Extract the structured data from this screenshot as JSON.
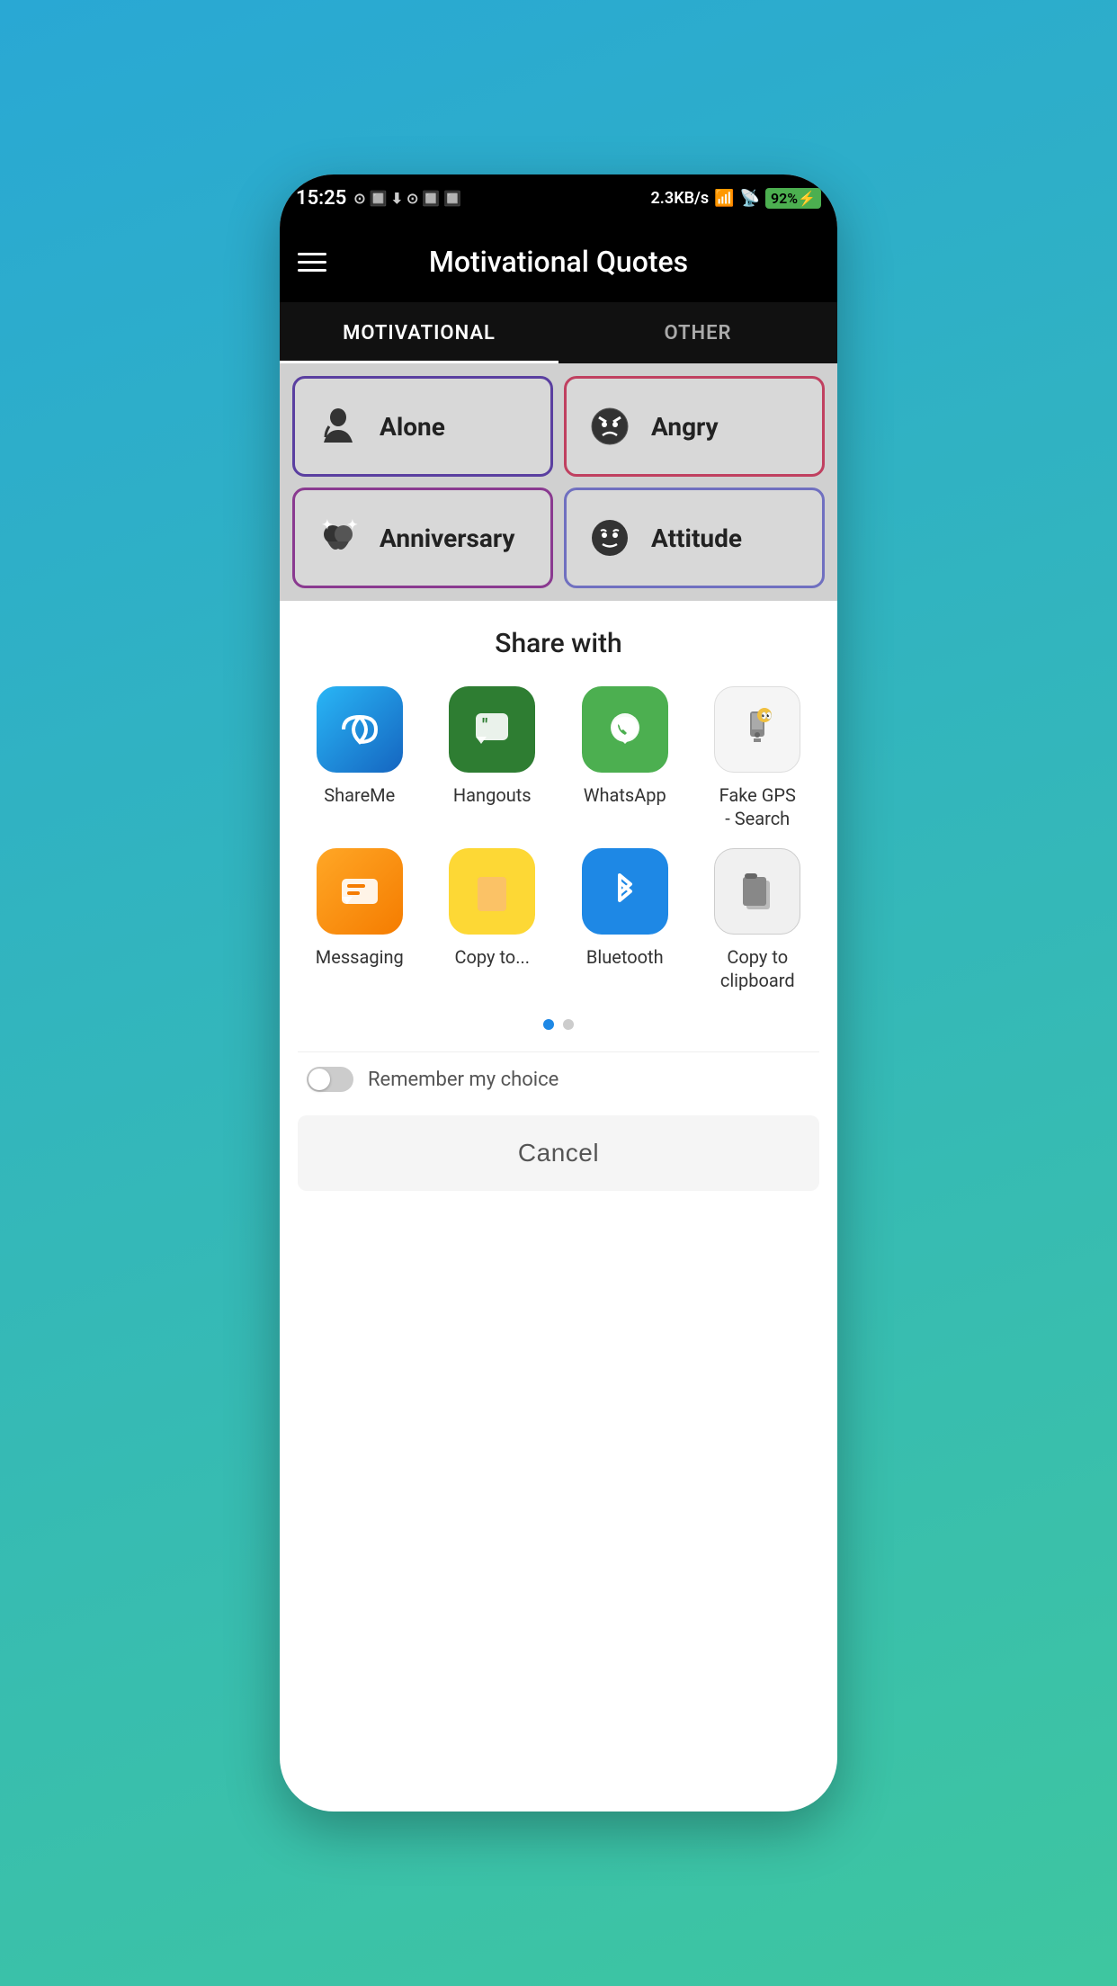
{
  "statusBar": {
    "time": "15:25",
    "speed": "2.3KB/s",
    "battery": "92"
  },
  "appBar": {
    "title": "Motivational Quotes",
    "menuIcon": "menu-icon"
  },
  "tabs": [
    {
      "id": "motivational",
      "label": "MOTIVATIONAL",
      "active": true
    },
    {
      "id": "other",
      "label": "OTHER",
      "active": false
    }
  ],
  "categories": [
    {
      "id": "alone",
      "label": "Alone",
      "icon": "🧎",
      "borderClass": "alone"
    },
    {
      "id": "angry",
      "label": "Angry",
      "icon": "😠",
      "borderClass": "angry"
    },
    {
      "id": "anniversary",
      "label": "Anniversary",
      "icon": "💑",
      "borderClass": "anniversary"
    },
    {
      "id": "attitude",
      "label": "Attitude",
      "icon": "😏",
      "borderClass": "attitude"
    }
  ],
  "shareSheet": {
    "title": "Share with",
    "items": [
      {
        "id": "shareme",
        "label": "ShareMe",
        "iconType": "blue-grad",
        "icon": "∞"
      },
      {
        "id": "hangouts",
        "label": "Hangouts",
        "iconType": "green-dark",
        "icon": "❝"
      },
      {
        "id": "whatsapp",
        "label": "WhatsApp",
        "iconType": "green-bright",
        "icon": "📱"
      },
      {
        "id": "fakegps",
        "label": "Fake GPS\n- Search",
        "iconType": "white-bg",
        "icon": "🤖"
      },
      {
        "id": "messaging",
        "label": "Messaging",
        "iconType": "orange-bg",
        "icon": "💬"
      },
      {
        "id": "copyto",
        "label": "Copy to...",
        "iconType": "yellow-bg",
        "icon": "📋"
      },
      {
        "id": "bluetooth",
        "label": "Bluetooth",
        "iconType": "blue-bt",
        "icon": "🔵"
      },
      {
        "id": "copyclipboard",
        "label": "Copy to clipboard",
        "iconType": "gray-bg",
        "icon": "📄"
      }
    ],
    "pagination": {
      "total": 2,
      "current": 0
    },
    "rememberLabel": "Remember my choice",
    "cancelLabel": "Cancel"
  }
}
